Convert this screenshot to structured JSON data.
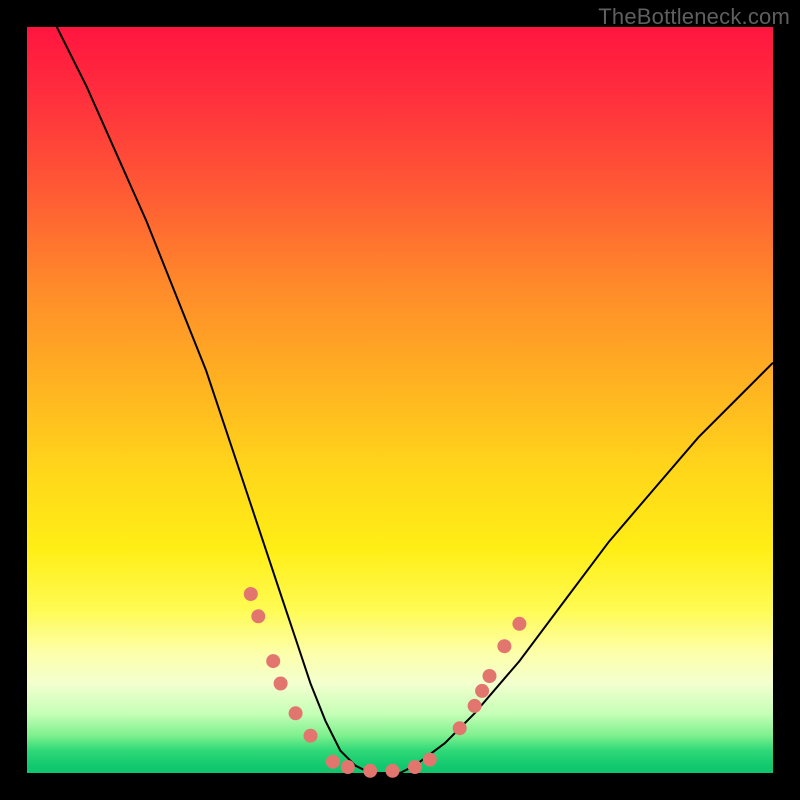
{
  "attribution": "TheBottleneck.com",
  "colors": {
    "page_bg": "#000000",
    "gradient_top": "#ff153f",
    "gradient_bottom": "#0fc46d",
    "curve": "#000000",
    "dots": "#e2766e"
  },
  "chart_data": {
    "type": "line",
    "title": "",
    "xlabel": "",
    "ylabel": "",
    "xlim": [
      0,
      100
    ],
    "ylim": [
      0,
      100
    ],
    "grid": false,
    "series": [
      {
        "name": "curve",
        "x": [
          4,
          8,
          12,
          16,
          20,
          24,
          28,
          30,
          32,
          34,
          36,
          38,
          40,
          42,
          44,
          46,
          48,
          50,
          52,
          56,
          60,
          66,
          72,
          78,
          84,
          90,
          96,
          100
        ],
        "y": [
          100,
          92,
          83,
          74,
          64,
          54,
          42,
          36,
          30,
          24,
          18,
          12,
          7,
          3,
          1,
          0,
          0,
          0,
          1,
          4,
          8,
          15,
          23,
          31,
          38,
          45,
          51,
          55
        ]
      }
    ],
    "points": [
      {
        "name": "left-cluster",
        "x": 30,
        "y": 24
      },
      {
        "name": "left-cluster",
        "x": 31,
        "y": 21
      },
      {
        "name": "left-cluster",
        "x": 33,
        "y": 15
      },
      {
        "name": "left-cluster",
        "x": 34,
        "y": 12
      },
      {
        "name": "left-cluster",
        "x": 36,
        "y": 8
      },
      {
        "name": "left-cluster",
        "x": 38,
        "y": 5
      },
      {
        "name": "bottom",
        "x": 41,
        "y": 1.5
      },
      {
        "name": "bottom",
        "x": 43,
        "y": 0.8
      },
      {
        "name": "bottom",
        "x": 46,
        "y": 0.3
      },
      {
        "name": "bottom",
        "x": 49,
        "y": 0.3
      },
      {
        "name": "bottom",
        "x": 52,
        "y": 0.8
      },
      {
        "name": "bottom",
        "x": 54,
        "y": 1.8
      },
      {
        "name": "right-cluster",
        "x": 58,
        "y": 6
      },
      {
        "name": "right-cluster",
        "x": 60,
        "y": 9
      },
      {
        "name": "right-cluster",
        "x": 61,
        "y": 11
      },
      {
        "name": "right-cluster",
        "x": 62,
        "y": 13
      },
      {
        "name": "right-cluster",
        "x": 64,
        "y": 17
      },
      {
        "name": "right-cluster",
        "x": 66,
        "y": 20
      }
    ]
  }
}
